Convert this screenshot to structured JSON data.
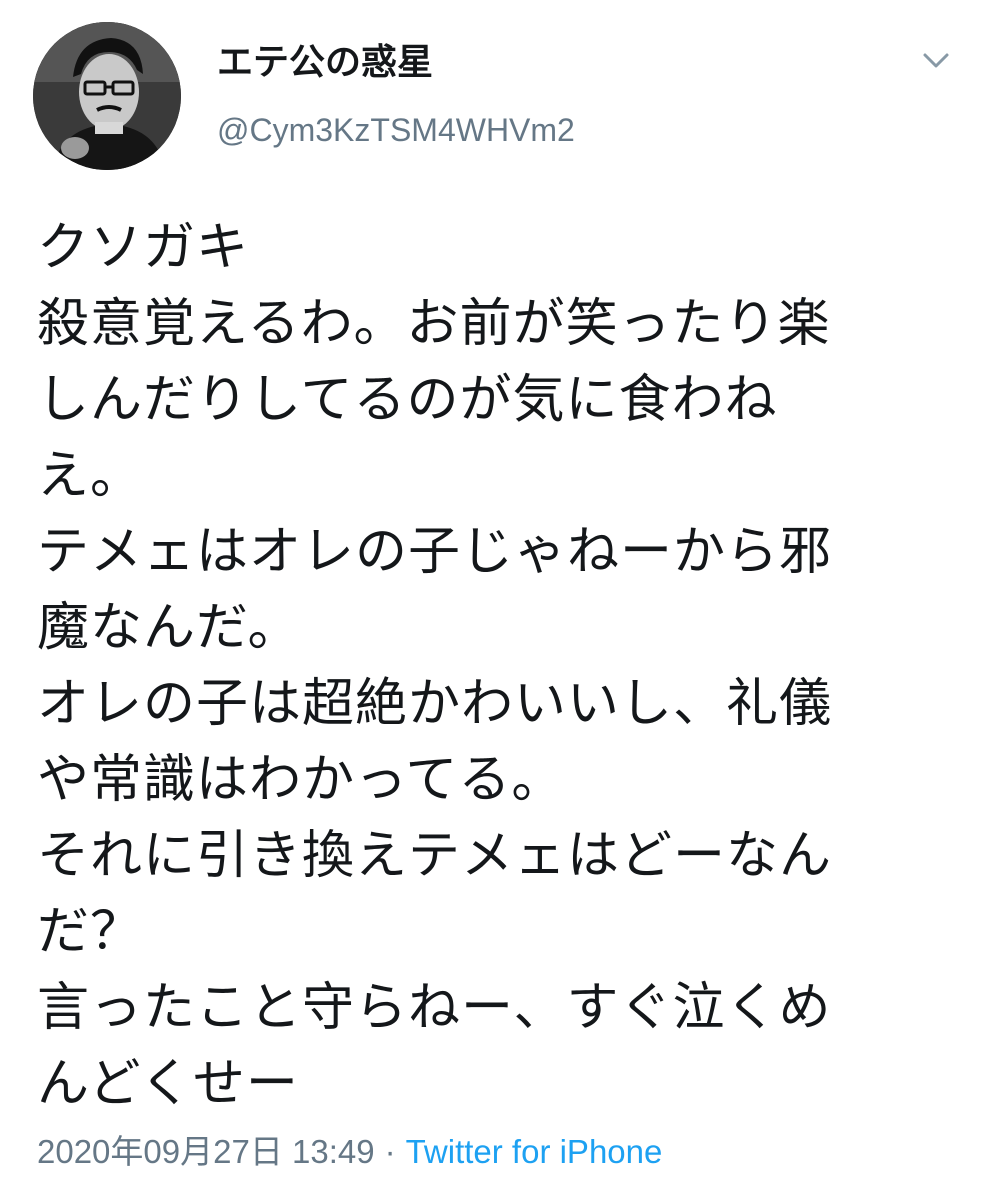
{
  "user": {
    "display_name": "エテ公の惑星",
    "handle": "@Cym3KzTSM4WHVm2"
  },
  "tweet": {
    "lines": [
      "クソガキ",
      "殺意覚えるわ。お前が笑ったり楽",
      "しんだりしてるのが気に食わね",
      "え。",
      "テメェはオレの子じゃねーから邪",
      "魔なんだ。",
      "オレの子は超絶かわいいし、礼儀",
      "や常識はわかってる。",
      "それに引き換えテメェはどーなん",
      "だ？",
      "言ったこと守らねー、すぐ泣くめ",
      "んどくせー"
    ],
    "timestamp": "2020年09月27日 13:49",
    "separator": "·",
    "source": "Twitter for iPhone"
  },
  "icons": {
    "avatar": "profile-photo",
    "caret": "chevron-down-icon"
  },
  "colors": {
    "text": "#14171a",
    "secondary": "#657786",
    "link": "#1da1f2"
  }
}
